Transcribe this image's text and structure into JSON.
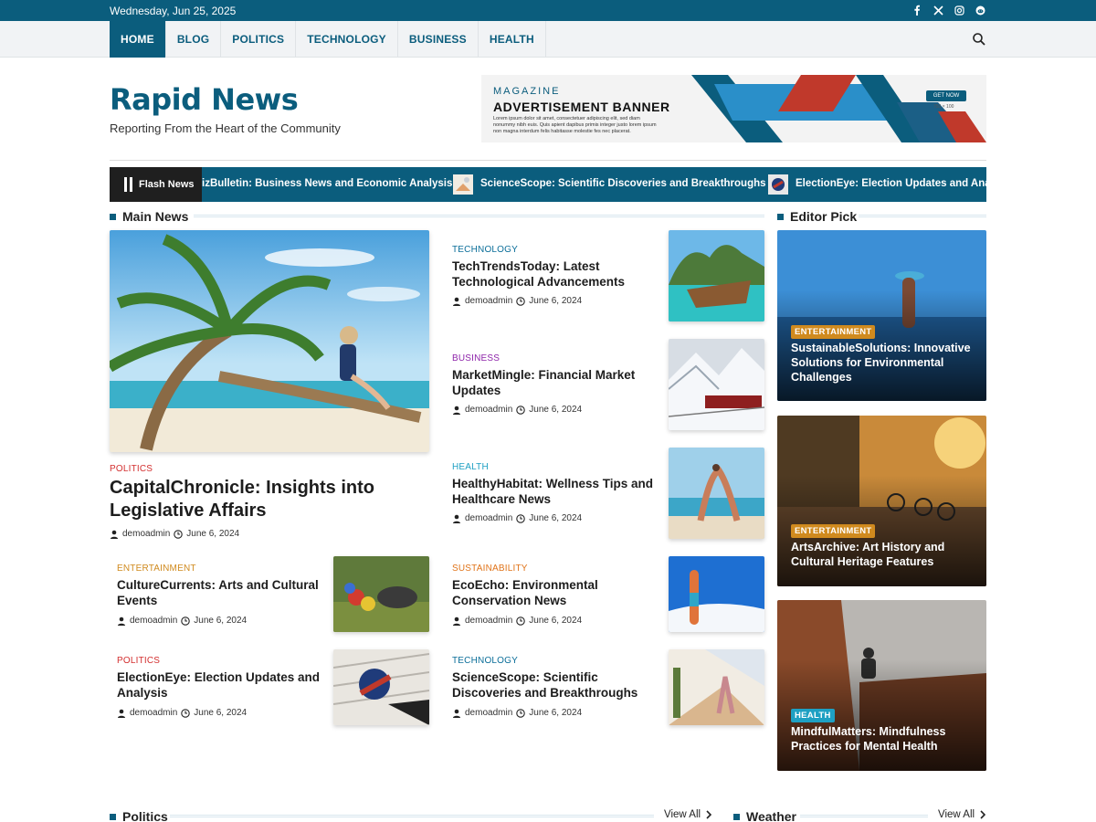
{
  "topbar": {
    "date": "Wednesday, Jun 25, 2025"
  },
  "nav": {
    "items": [
      "HOME",
      "BLOG",
      "POLITICS",
      "TECHNOLOGY",
      "BUSINESS",
      "HEALTH"
    ]
  },
  "brand": {
    "title": "Rapid News",
    "tagline": "Reporting From the Heart of the Community"
  },
  "ad": {
    "kicker": "MAGAZINE",
    "headline": "ADVERTISEMENT BANNER",
    "body": "Lorem ipsum dolor sit amet, consectetuer adipiscing elit, sed diam nonummy nibh euis. Quis apient dapibus primis integer justo lorem ipsum non magna interdum felis habitasse molestie fes nec placerat.",
    "cta": "GET NOW",
    "size": "750 × 100"
  },
  "flash": {
    "label": "Flash News",
    "items": [
      "izBulletin: Business News and Economic Analysis",
      "ScienceScope: Scientific Discoveries and Breakthroughs",
      "ElectionEye: Election Updates and Analy"
    ]
  },
  "sections": {
    "main": "Main News",
    "editor": "Editor Pick",
    "politics": "Politics",
    "weather": "Weather",
    "view_all": "View All"
  },
  "main_feature": {
    "category": "POLITICS",
    "title": "CapitalChronicle: Insights into Legislative Affairs",
    "author": "demoadmin",
    "date": "June 6, 2024"
  },
  "left_list": [
    {
      "category": "ENTERTAINMENT",
      "title": "CultureCurrents: Arts and Cultural Events",
      "author": "demoadmin",
      "date": "June 6, 2024"
    },
    {
      "category": "POLITICS",
      "title": "ElectionEye: Election Updates and Analysis",
      "author": "demoadmin",
      "date": "June 6, 2024"
    }
  ],
  "right_list": [
    {
      "category": "TECHNOLOGY",
      "title": "TechTrendsToday: Latest Technological Advancements",
      "author": "demoadmin",
      "date": "June 6, 2024"
    },
    {
      "category": "BUSINESS",
      "title": "MarketMingle: Financial Market Updates",
      "author": "demoadmin",
      "date": "June 6, 2024"
    },
    {
      "category": "HEALTH",
      "title": "HealthyHabitat: Wellness Tips and Healthcare News",
      "author": "demoadmin",
      "date": "June 6, 2024"
    },
    {
      "category": "SUSTAINABILITY",
      "title": "EcoEcho: Environmental Conservation News",
      "author": "demoadmin",
      "date": "June 6, 2024"
    },
    {
      "category": "TECHNOLOGY",
      "title": "ScienceScope: Scientific Discoveries and Breakthroughs",
      "author": "demoadmin",
      "date": "June 6, 2024"
    }
  ],
  "editor_picks": [
    {
      "category": "ENTERTAINMENT",
      "title": "SustainableSolutions: Innovative Solutions for Environmental Challenges"
    },
    {
      "category": "ENTERTAINMENT",
      "title": "ArtsArchive: Art History and Cultural Heritage Features"
    },
    {
      "category": "HEALTH",
      "title": "MindfulMatters: Mindfulness Practices for Mental Health"
    }
  ],
  "colors": {
    "brand": "#0b5d7d",
    "politics": "#d32f2f",
    "technology": "#0b6e99",
    "business": "#8e24aa",
    "health": "#1ea0c3",
    "entertainment": "#d08a1e",
    "sustainability": "#e0741a"
  },
  "icons": [
    "facebook-icon",
    "x-icon",
    "instagram-icon",
    "reddit-icon",
    "search-icon",
    "user-icon",
    "clock-icon",
    "chevron-right-icon",
    "pause-icon"
  ]
}
